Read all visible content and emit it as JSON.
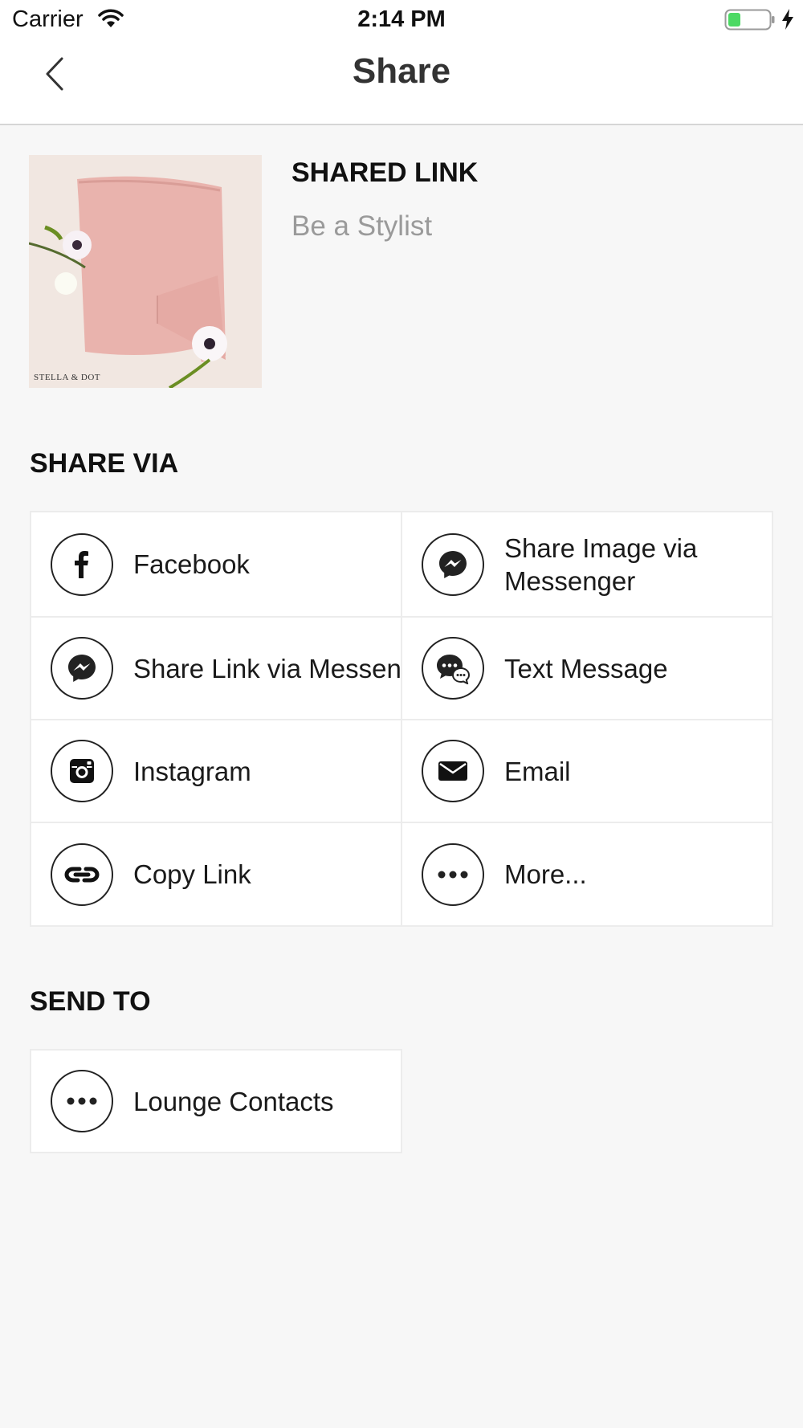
{
  "status_bar": {
    "carrier": "Carrier",
    "time": "2:14 PM",
    "battery_color": "#4cd964"
  },
  "nav": {
    "title": "Share",
    "back_icon": "chevron-left-icon"
  },
  "shared_link": {
    "title": "SHARED LINK",
    "subtitle": "Be a Stylist",
    "image_caption": "STELLA & DOT"
  },
  "share_via": {
    "heading": "SHARE VIA",
    "options": [
      {
        "label": "Facebook",
        "icon": "facebook-icon"
      },
      {
        "label_line1": "Share Image via",
        "label_line2": "Messenger",
        "icon": "messenger-icon"
      },
      {
        "label": "Share Link via Messenger",
        "icon": "messenger-icon"
      },
      {
        "label": "Text Message",
        "icon": "text-message-icon"
      },
      {
        "label": "Instagram",
        "icon": "instagram-icon"
      },
      {
        "label": "Email",
        "icon": "email-icon"
      },
      {
        "label": "Copy Link",
        "icon": "link-icon"
      },
      {
        "label": "More...",
        "icon": "more-icon"
      }
    ]
  },
  "send_to": {
    "heading": "SEND TO",
    "options": [
      {
        "label": "Lounge Contacts",
        "icon": "more-icon"
      }
    ]
  }
}
